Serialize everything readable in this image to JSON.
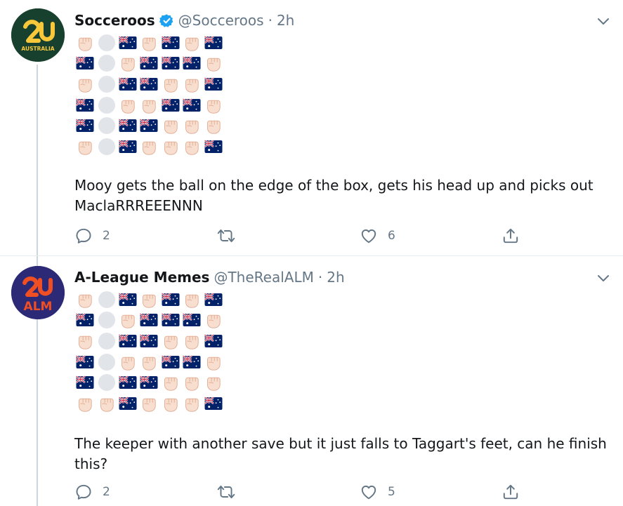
{
  "colors": {
    "name": "#14171a",
    "muted": "#657786",
    "verified": "#1da1f2",
    "thread_line": "#ccd6dd",
    "fist": "#f7dece",
    "fist_outline": "#e0a990",
    "blank_circle": "#e1e4e8",
    "flag_blue": "#012169",
    "flag_red": "#c8102e"
  },
  "tweets": [
    {
      "author": "Socceroos",
      "verified": true,
      "handle": "@Socceroos",
      "separator": "·",
      "time": "2h",
      "avatar_icon": "socceroos-logo-icon",
      "avatar_text": "AUSTRALIA",
      "emoji_grid": [
        [
          "fist",
          "blank",
          "flag",
          "fist",
          "flag",
          "fist",
          "flag"
        ],
        [
          "flag",
          "blank",
          "fist",
          "flag",
          "flag",
          "flag",
          "fist"
        ],
        [
          "fist",
          "blank",
          "flag",
          "flag",
          "fist",
          "fist",
          "flag"
        ],
        [
          "flag",
          "blank",
          "fist",
          "fist",
          "flag",
          "flag",
          "fist"
        ],
        [
          "flag",
          "blank",
          "flag",
          "flag",
          "fist",
          "fist",
          "fist"
        ],
        [
          "fist",
          "blank",
          "flag",
          "fist",
          "fist",
          "fist",
          "flag"
        ]
      ],
      "text": "Mooy gets the ball on the edge of the box, gets his head up and picks out MaclaRRREEENNN",
      "reply_count": "2",
      "retweet_count": "",
      "like_count": "6"
    },
    {
      "author": "A-League Memes",
      "verified": false,
      "handle": "@TheRealALM",
      "separator": "·",
      "time": "2h",
      "avatar_icon": "alm-logo-icon",
      "avatar_text": "ALM",
      "emoji_grid": [
        [
          "fist",
          "blank",
          "flag",
          "fist",
          "flag",
          "fist",
          "flag"
        ],
        [
          "flag",
          "blank",
          "fist",
          "flag",
          "flag",
          "flag",
          "fist"
        ],
        [
          "fist",
          "blank",
          "flag",
          "flag",
          "fist",
          "fist",
          "flag"
        ],
        [
          "flag",
          "blank",
          "fist",
          "fist",
          "flag",
          "flag",
          "fist"
        ],
        [
          "flag",
          "blank",
          "flag",
          "flag",
          "fist",
          "fist",
          "fist"
        ],
        [
          "fist",
          "fist",
          "flag",
          "fist",
          "fist",
          "fist",
          "flag"
        ]
      ],
      "text": "The keeper with another save but it just falls to Taggart's feet, can he finish this?",
      "reply_count": "2",
      "retweet_count": "",
      "like_count": "5"
    }
  ]
}
